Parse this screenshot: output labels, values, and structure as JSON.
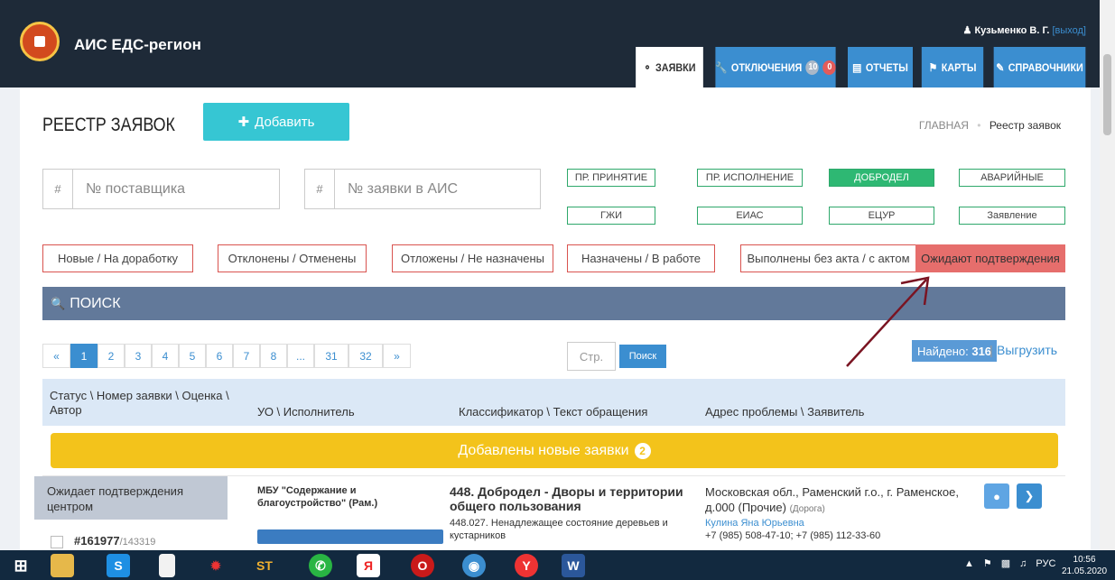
{
  "header": {
    "app_title": "АИС ЕДС-регион",
    "user_name": "Кузьменко В. Г.",
    "logout": "[выход]",
    "tabs": [
      {
        "label": "ЗАЯВКИ",
        "icon": "lifebuoy-icon"
      },
      {
        "label": "ОТКЛЮЧЕНИЯ",
        "icon": "wrench-icon",
        "badge_blue": "10",
        "badge_red": "0"
      },
      {
        "label": "ОТЧЕТЫ",
        "icon": "chart-icon"
      },
      {
        "label": "КАРТЫ",
        "icon": "map-icon"
      },
      {
        "label": "СПРАВОЧНИКИ",
        "icon": "edit-icon"
      }
    ]
  },
  "page": {
    "title": "РЕЕСТР ЗАЯВОК",
    "add_button": "Добавить",
    "breadcrumb": {
      "home": "ГЛАВНАЯ",
      "separator": "•",
      "current": "Реестр заявок"
    }
  },
  "inputs": {
    "supplier": {
      "prefix": "#",
      "placeholder": "№ поставщика"
    },
    "ais": {
      "prefix": "#",
      "placeholder": "№ заявки в АИС"
    }
  },
  "source_chips": [
    "ПР. ПРИНЯТИЕ",
    "ПР. ИСПОЛНЕНИЕ",
    "ДОБРОДЕЛ",
    "АВАРИЙНЫЕ",
    "ГЖИ",
    "ЕИАС",
    "ЕЦУР",
    "Заявление"
  ],
  "status_filters": [
    "Новые / На доработку",
    "Отклонены / Отменены",
    "Отложены / Не назначены",
    "Назначены / В работе",
    "Выполнены без акта / с актом",
    "Ожидают подтверждения"
  ],
  "search": {
    "label": "ПОИСК"
  },
  "pagination": {
    "pages": [
      "«",
      "1",
      "2",
      "3",
      "4",
      "5",
      "6",
      "7",
      "8",
      "...",
      "31",
      "32",
      "»"
    ],
    "active": "1",
    "page_placeholder": "Стр.",
    "go_label": "Поиск",
    "found_label": "Найдено:",
    "found_count": "316",
    "separator": "|",
    "export_label": "Выгрузить"
  },
  "table": {
    "headers": [
      "Статус \\ Номер заявки \\ Оценка \\ Автор",
      "УО \\ Исполнитель",
      "Классификатор \\ Текст обращения",
      "Адрес проблемы \\ Заявитель"
    ],
    "new_banner": "Добавлены новые заявки",
    "new_count": "2",
    "row": {
      "tooltip": "Ожидает подтверждения центром",
      "number": "#161977",
      "sub_number": "/143319",
      "org": "МБУ \"Содержание и благоустройство\" (Рам.)",
      "class_title": "448. Добродел - Дворы и территории общего пользования",
      "class_sub": "448.027. Ненадлежащее состояние деревьев и кустарников",
      "address": "Московская обл., Раменский г.о., г. Раменское, д.000 (Прочие)",
      "address_tag": "(Дорога)",
      "applicant": "Кулина Яна Юрьевна",
      "phones": "+7 (985) 508-47-10; +7 (985) 112-33-60"
    }
  },
  "taskbar": {
    "lang": "РУС",
    "time": "10:56",
    "date": "21.05.2020"
  },
  "colors": {
    "header": "#1e2a38",
    "tab": "#3b8ed0",
    "accent_cyan": "#36c6d3",
    "search_bar": "#62799a",
    "banner": "#f3c31b",
    "active_filter": "#e66e6c",
    "annotation_arrow": "#7a1422"
  }
}
